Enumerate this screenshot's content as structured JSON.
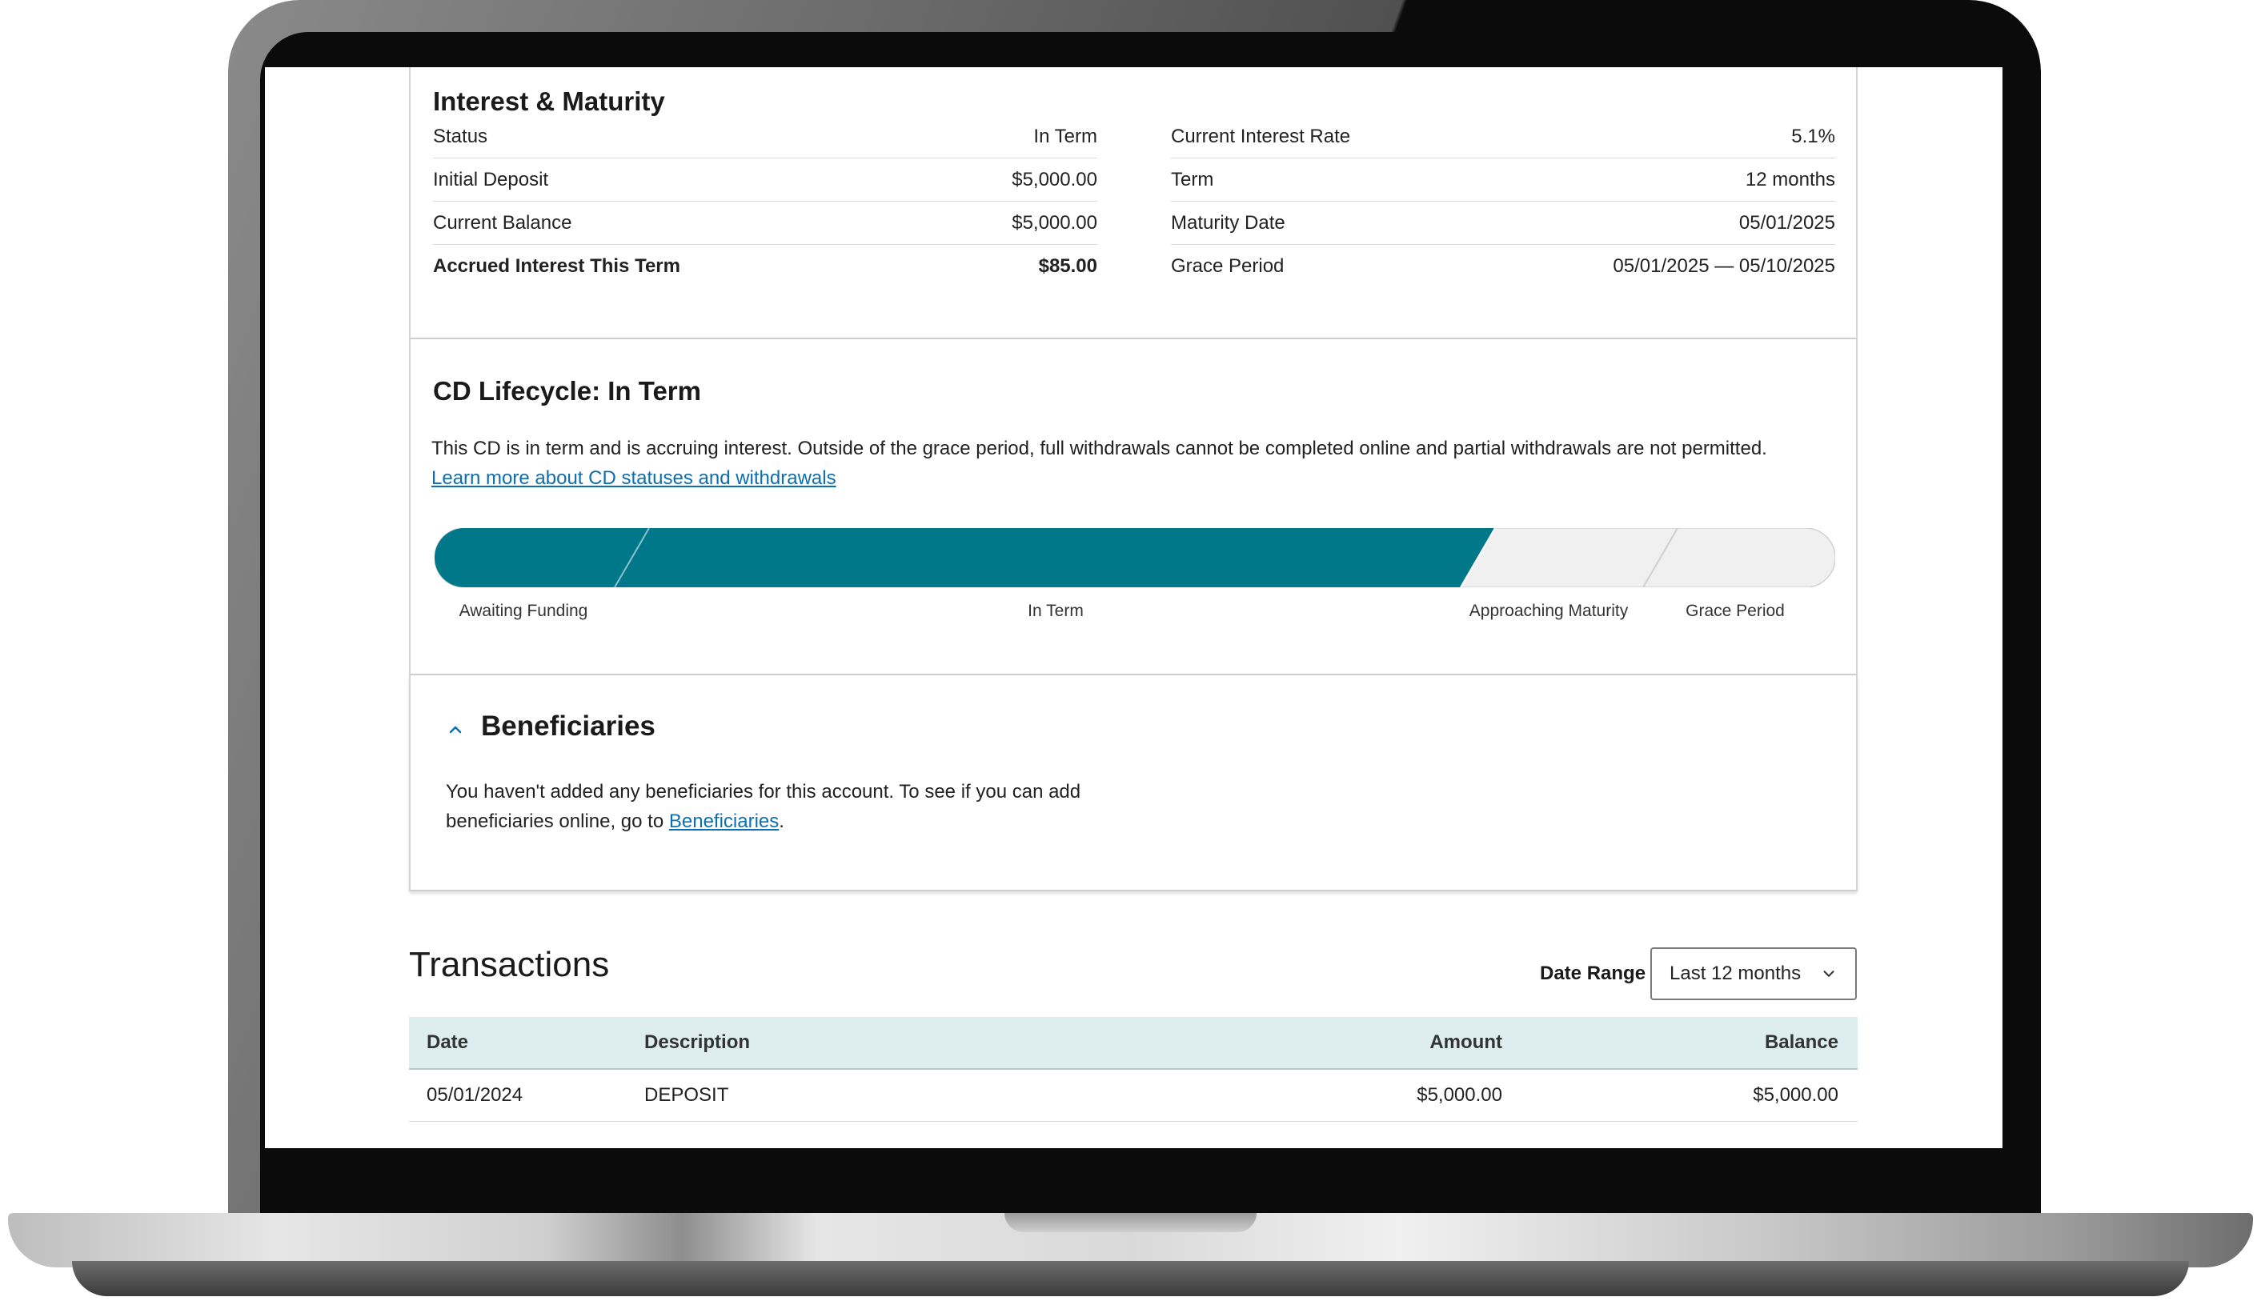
{
  "interest": {
    "title": "Interest & Maturity",
    "left": [
      {
        "label": "Status",
        "value": "In Term"
      },
      {
        "label": "Initial Deposit",
        "value": "$5,000.00"
      },
      {
        "label": "Current Balance",
        "value": "$5,000.00"
      },
      {
        "label": "Accrued Interest This Term",
        "value": "$85.00"
      }
    ],
    "right": [
      {
        "label": "Current Interest Rate",
        "value": "5.1%"
      },
      {
        "label": "Term",
        "value": "12 months"
      },
      {
        "label": "Maturity Date",
        "value": "05/01/2025"
      },
      {
        "label": "Grace Period",
        "value": "05/01/2025 — 05/10/2025"
      }
    ]
  },
  "lifecycle": {
    "title": "CD Lifecycle: In Term",
    "description": "This CD is in term and is accruing interest. Outside of the grace period, full withdrawals cannot be completed online and partial withdrawals are not permitted.",
    "link": "Learn more about CD statuses and withdrawals",
    "stages": [
      "Awaiting Funding",
      "In Term",
      "Approaching Maturity",
      "Grace Period"
    ],
    "active_color": "#00788a",
    "inactive_color": "#f0f0f0"
  },
  "beneficiaries": {
    "title": "Beneficiaries",
    "text": "You haven't added any beneficiaries for this account. To see if you can add beneficiaries online, go to ",
    "link": "Beneficiaries",
    "after_link": "."
  },
  "transactions": {
    "title": "Transactions",
    "date_range_label": "Date Range",
    "date_range_value": "Last 12 months",
    "columns": [
      "Date",
      "Description",
      "Amount",
      "Balance"
    ],
    "rows": [
      [
        "05/01/2024",
        "DEPOSIT",
        "$5,000.00",
        "$5,000.00"
      ]
    ]
  },
  "icons": {
    "expand": "chevron-up-icon",
    "dropdown": "chevron-down-icon"
  }
}
